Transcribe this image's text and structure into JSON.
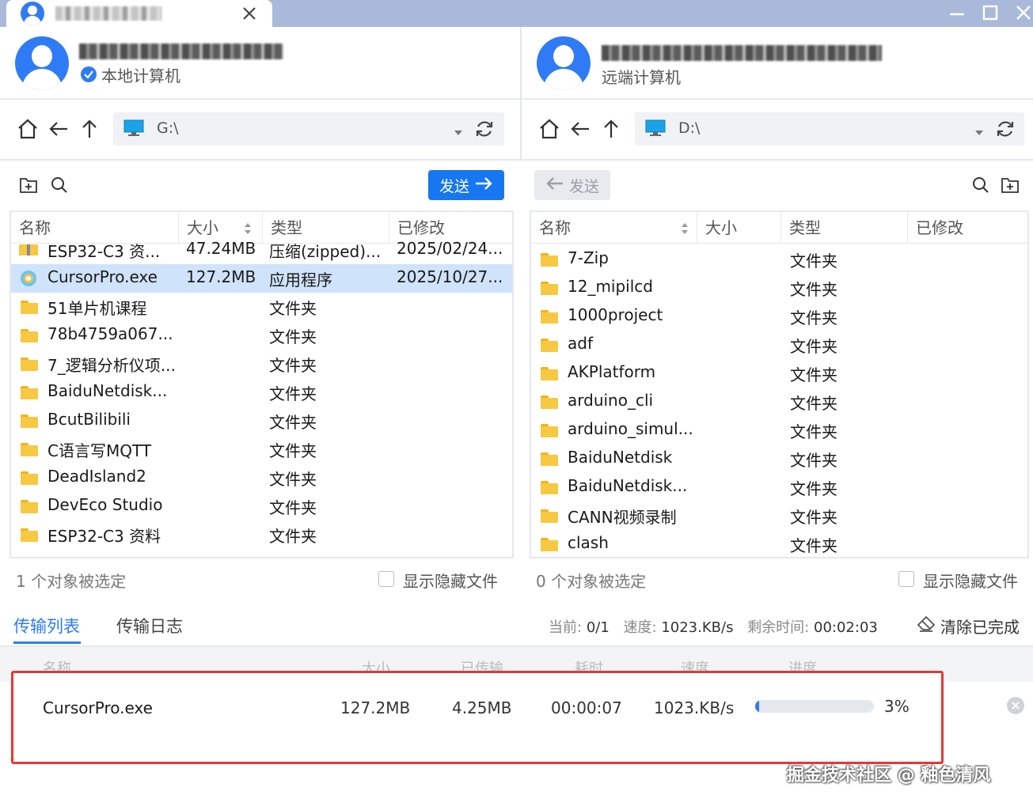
{
  "window": {
    "minimize_icon": "minimize-icon",
    "maximize_icon": "maximize-icon",
    "close_icon": "close-icon"
  },
  "tab": {
    "close_icon": "close-icon"
  },
  "local": {
    "host_label": "本地计算机",
    "path": "G:\\",
    "send_label": "发送",
    "columns": [
      "名称",
      "大小",
      "类型",
      "已修改"
    ],
    "files": [
      {
        "name": "ESP32-C3 资...",
        "size": "47.24MB",
        "type": "压缩(zipped)...",
        "modified": "2025/02/24...",
        "icon": "zip-icon"
      },
      {
        "name": "CursorPro.exe",
        "size": "127.2MB",
        "type": "应用程序",
        "modified": "2025/10/27...",
        "icon": "app-icon"
      },
      {
        "name": "51单片机课程",
        "size": "",
        "type": "文件夹",
        "modified": "",
        "icon": "folder-icon"
      },
      {
        "name": "78b4759a067...",
        "size": "",
        "type": "文件夹",
        "modified": "",
        "icon": "folder-icon"
      },
      {
        "name": "7_逻辑分析仪项...",
        "size": "",
        "type": "文件夹",
        "modified": "",
        "icon": "folder-icon"
      },
      {
        "name": "BaiduNetdisk...",
        "size": "",
        "type": "文件夹",
        "modified": "",
        "icon": "folder-icon"
      },
      {
        "name": "BcutBilibili",
        "size": "",
        "type": "文件夹",
        "modified": "",
        "icon": "folder-icon"
      },
      {
        "name": "C语言写MQTT",
        "size": "",
        "type": "文件夹",
        "modified": "",
        "icon": "folder-icon"
      },
      {
        "name": "DeadIsland2",
        "size": "",
        "type": "文件夹",
        "modified": "",
        "icon": "folder-icon"
      },
      {
        "name": "DevEco Studio",
        "size": "",
        "type": "文件夹",
        "modified": "",
        "icon": "folder-icon"
      },
      {
        "name": "ESP32-C3 资料",
        "size": "",
        "type": "文件夹",
        "modified": "",
        "icon": "folder-icon"
      }
    ],
    "selected_count": "1 个对象被选定",
    "show_hidden": "显示隐藏文件"
  },
  "remote": {
    "host_label": "远端计算机",
    "path": "D:\\",
    "send_label": "发送",
    "columns": [
      "名称",
      "大小",
      "类型",
      "已修改"
    ],
    "files": [
      {
        "name": "7-Zip",
        "type": "文件夹"
      },
      {
        "name": "12_mipilcd",
        "type": "文件夹"
      },
      {
        "name": "1000project",
        "type": "文件夹"
      },
      {
        "name": "adf",
        "type": "文件夹"
      },
      {
        "name": "AKPlatform",
        "type": "文件夹"
      },
      {
        "name": "arduino_cli",
        "type": "文件夹"
      },
      {
        "name": "arduino_simul...",
        "type": "文件夹"
      },
      {
        "name": "BaiduNetdisk",
        "type": "文件夹"
      },
      {
        "name": "BaiduNetdisk...",
        "type": "文件夹"
      },
      {
        "name": "CANN视频录制",
        "type": "文件夹"
      },
      {
        "name": "clash",
        "type": "文件夹"
      }
    ],
    "selected_count": "0 个对象被选定",
    "show_hidden": "显示隐藏文件"
  },
  "transfer": {
    "tabs": [
      "传输列表",
      "传输日志"
    ],
    "current_label": "当前:",
    "current_value": "0/1",
    "speed_label": "速度:",
    "speed_value": "1023.KB/s",
    "remaining_label": "剩余时间:",
    "remaining_value": "00:02:03",
    "clear_label": "清除已完成",
    "columns": [
      "名称",
      "大小",
      "已传输",
      "耗时",
      "速度",
      "进度"
    ],
    "item": {
      "name": "CursorPro.exe",
      "size": "127.2MB",
      "transferred": "4.25MB",
      "elapsed": "00:00:07",
      "speed": "1023.KB/s",
      "progress": 3,
      "progress_text": "3%"
    },
    "highlight_color": "#e53935"
  },
  "watermark": "掘金技术社区 @ 釉色清风",
  "colors": {
    "accent": "#2f7bf5",
    "titlebar": "#a9b9da",
    "selected_row": "#cfe3fb"
  }
}
